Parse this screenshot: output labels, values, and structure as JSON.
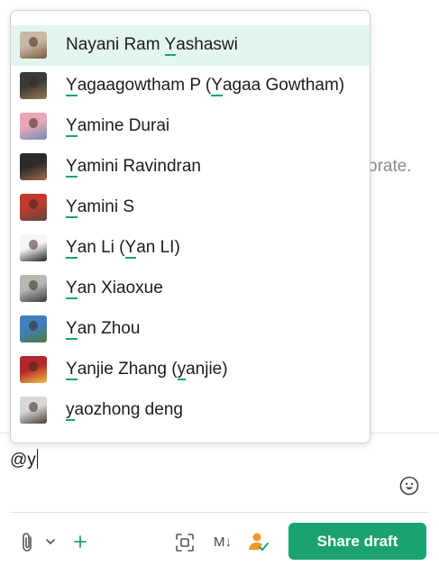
{
  "background": {
    "hint_text": "orate."
  },
  "mention_dropdown": {
    "query": "y",
    "items": [
      {
        "parts": [
          {
            "t": "N"
          },
          {
            "t": "a"
          },
          {
            "t": "yani Ram "
          },
          {
            "t": "Y",
            "hl": true
          },
          {
            "t": "ashaswi"
          }
        ],
        "display": "Nayani Ram Yashaswi",
        "selected": true,
        "avatar_colors": [
          "#c9b9a4",
          "#7a5a3e"
        ]
      },
      {
        "parts": [
          {
            "t": "Y",
            "hl": true
          },
          {
            "t": "agaagowtham P ("
          },
          {
            "t": "Y",
            "hl": true
          },
          {
            "t": "agaa Gowtham)"
          }
        ],
        "display": "Yagaagowtham P (Yagaa Gowtham)",
        "selected": false,
        "avatar_colors": [
          "#3a3a3a",
          "#9a7b4f"
        ]
      },
      {
        "parts": [
          {
            "t": "Y",
            "hl": true
          },
          {
            "t": "amine Durai"
          }
        ],
        "display": "Yamine Durai",
        "selected": false,
        "avatar_colors": [
          "#e8a8b5",
          "#6a8fb8"
        ]
      },
      {
        "parts": [
          {
            "t": "Y",
            "hl": true
          },
          {
            "t": "amini Ravindran"
          }
        ],
        "display": "Yamini Ravindran",
        "selected": false,
        "avatar_colors": [
          "#2b2b2b",
          "#a26a4a"
        ]
      },
      {
        "parts": [
          {
            "t": "Y",
            "hl": true
          },
          {
            "t": "amini S"
          }
        ],
        "display": "Yamini S",
        "selected": false,
        "avatar_colors": [
          "#c0392b",
          "#5a4a40"
        ]
      },
      {
        "parts": [
          {
            "t": "Y",
            "hl": true
          },
          {
            "t": "an Li ("
          },
          {
            "t": "Y",
            "hl": true
          },
          {
            "t": "an LI)"
          }
        ],
        "display": "Yan Li (Yan LI)",
        "selected": false,
        "avatar_colors": [
          "#f5f5f5",
          "#222222"
        ]
      },
      {
        "parts": [
          {
            "t": "Y",
            "hl": true
          },
          {
            "t": "an Xiaoxue"
          }
        ],
        "display": "Yan Xiaoxue",
        "selected": false,
        "avatar_colors": [
          "#b5b8b0",
          "#3b3b3b"
        ]
      },
      {
        "parts": [
          {
            "t": "Y",
            "hl": true
          },
          {
            "t": "an Zhou"
          }
        ],
        "display": "Yan Zhou",
        "selected": false,
        "avatar_colors": [
          "#3f7fbf",
          "#4f7a3a"
        ]
      },
      {
        "parts": [
          {
            "t": "Y",
            "hl": true
          },
          {
            "t": "anjie Zhang ("
          },
          {
            "t": "y",
            "hl": true
          },
          {
            "t": "anjie)"
          }
        ],
        "display": "Yanjie Zhang (yanjie)",
        "selected": false,
        "avatar_colors": [
          "#b3262b",
          "#f0c040"
        ]
      },
      {
        "parts": [
          {
            "t": "y",
            "hl": true
          },
          {
            "t": "aozhong deng"
          }
        ],
        "display": "yaozhong deng",
        "selected": false,
        "avatar_colors": [
          "#d8d8d8",
          "#4a3c34"
        ]
      }
    ]
  },
  "composer": {
    "text": "@y"
  },
  "toolbar": {
    "markdown_label": "M↓",
    "share_label": "Share draft"
  },
  "colors": {
    "accent": "#1aa36f",
    "selected_bg": "#e3f6ee"
  }
}
